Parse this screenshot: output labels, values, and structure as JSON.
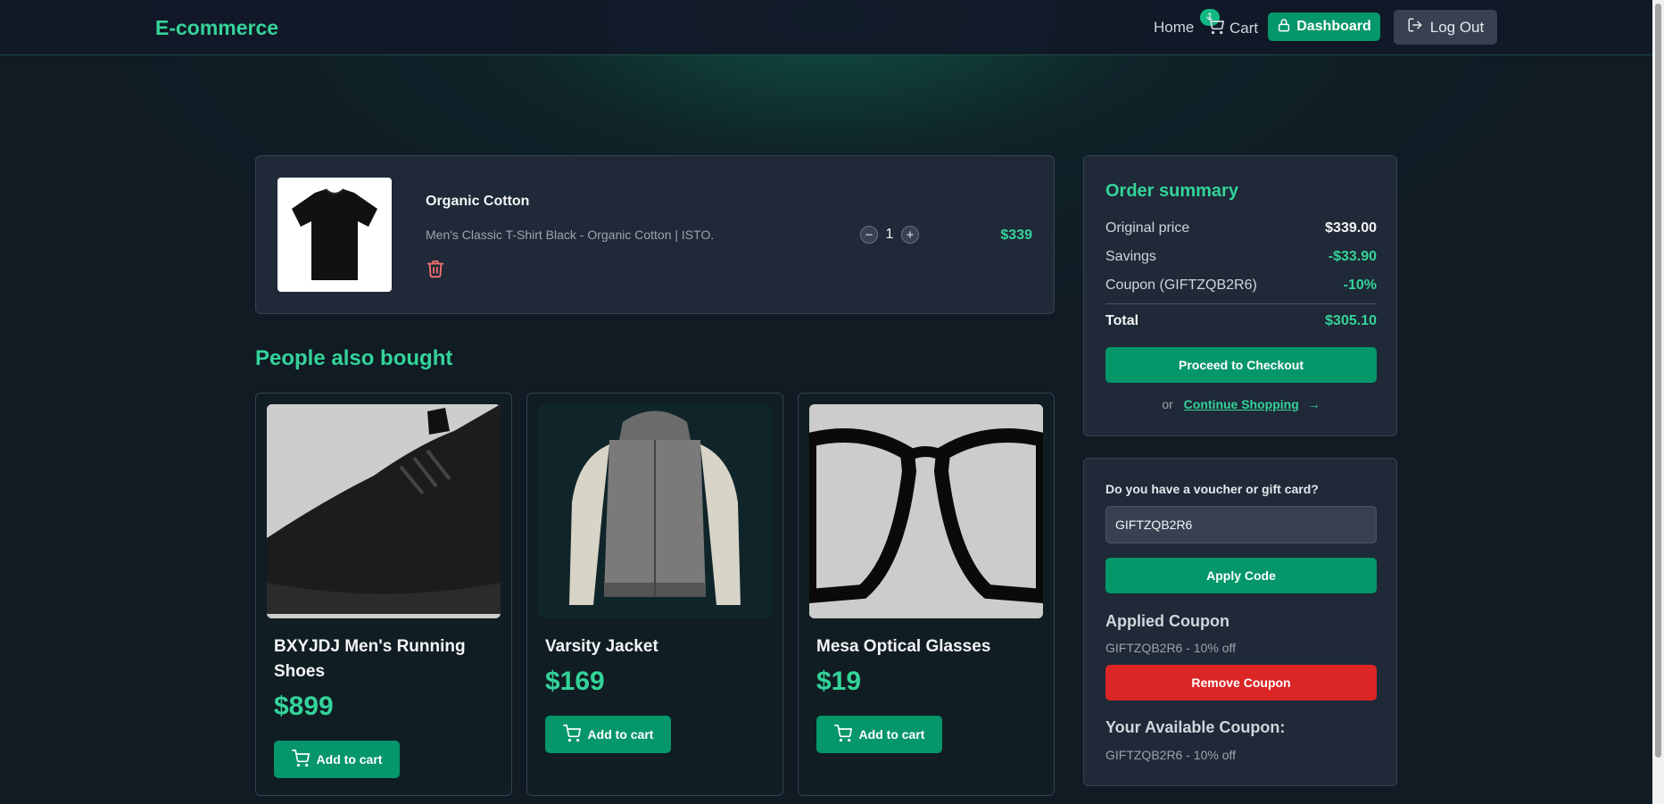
{
  "header": {
    "brand": "E-commerce",
    "home_label": "Home",
    "cart_label": "Cart",
    "cart_count": "1",
    "dashboard_label": "Dashboard",
    "logout_label": "Log Out"
  },
  "cart_item": {
    "name": "Organic Cotton",
    "description": "Men's Classic T-Shirt Black - Organic Cotton | ISTO.",
    "quantity": "1",
    "price": "$339",
    "minus_symbol": "−",
    "plus_symbol": "+"
  },
  "recommendations": {
    "title": "People also bought",
    "items": [
      {
        "name": "BXYJDJ Men's Running Shoes",
        "price": "$899",
        "button": "Add to cart"
      },
      {
        "name": "Varsity Jacket",
        "price": "$169",
        "button": "Add to cart"
      },
      {
        "name": "Mesa Optical Glasses",
        "price": "$19",
        "button": "Add to cart"
      }
    ]
  },
  "summary": {
    "title": "Order summary",
    "rows": [
      {
        "label": "Original price",
        "value": "$339.00"
      },
      {
        "label": "Savings",
        "value": "-$33.90"
      },
      {
        "label": "Coupon (GIFTZQB2R6)",
        "value": "-10%"
      }
    ],
    "total_label": "Total",
    "total_value": "$305.10",
    "checkout_label": "Proceed to Checkout",
    "or_text": "or",
    "continue_label": "Continue Shopping",
    "arrow": "→"
  },
  "coupon": {
    "question": "Do you have a voucher or gift card?",
    "input_value": "GIFTZQB2R6",
    "apply_label": "Apply Code",
    "applied_heading": "Applied Coupon",
    "applied_text": "GIFTZQB2R6 - 10% off",
    "remove_label": "Remove Coupon",
    "available_heading": "Your Available Coupon:",
    "available_text": "GIFTZQB2R6 - 10% off"
  },
  "colors": {
    "accent": "#34d399",
    "button_green": "#059669",
    "danger": "#dc2626",
    "panel": "#1f2937"
  },
  "icons": [
    "cart-icon",
    "lock-icon",
    "logout-icon",
    "trash-icon",
    "minus-icon",
    "plus-icon",
    "arrow-right-icon"
  ]
}
